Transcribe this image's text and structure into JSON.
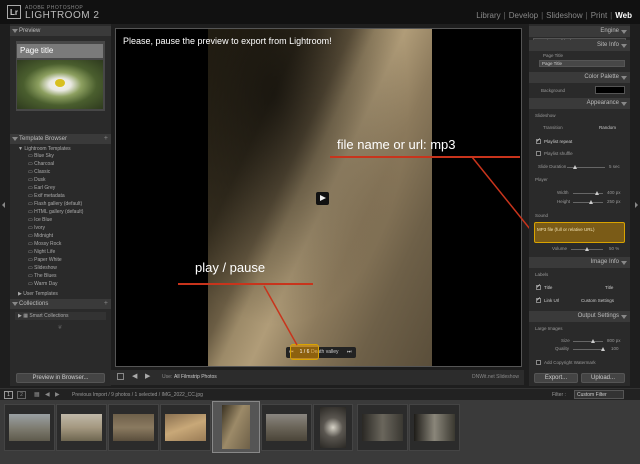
{
  "app": {
    "vendor": "ADOBE PHOTOSHOP",
    "name": "LIGHTROOM 2",
    "badge": "Lr"
  },
  "modules": [
    "Library",
    "Develop",
    "Slideshow",
    "Print",
    "Web"
  ],
  "active_module": "Web",
  "left_panel": {
    "preview_header": "Preview",
    "preview_caption": "Page title",
    "template_browser_header": "Template Browser",
    "lightroom_templates": "Lightroom Templates",
    "templates": [
      "Blue Sky",
      "Charcoal",
      "Classic",
      "Dusk",
      "Earl Grey",
      "Exif metadata",
      "Flash gallery (default)",
      "HTML gallery (default)",
      "Ice Blue",
      "Ivory",
      "Midnight",
      "Mossy Rock",
      "Night Life",
      "Paper White",
      "Slideshow",
      "The Blues",
      "Warm Day"
    ],
    "user_templates": "User Templates",
    "collections_header": "Collections",
    "smart_collections": "Smart Collections",
    "preview_button": "Preview in Browser..."
  },
  "center": {
    "notice": "Please, pause the preview to export from Lightroom!",
    "pill_text": "1 / 6",
    "ctrl_label": "Death valley",
    "annotation_mp3": "file name or url: mp3",
    "annotation_play": "play / pause"
  },
  "center_bar": {
    "use_label": "Use:",
    "use_value": "All Filmstrip Photos",
    "engine_label": "DNWit.net Slideshow"
  },
  "right_panel": {
    "engine_header": "Engine",
    "engine_value": "DNWit.net Slideshow",
    "site_info_header": "Site Info",
    "site_info_label": "Page Title",
    "site_info_value": "Page Title",
    "color_palette_header": "Color Palette",
    "background_label": "Background",
    "appearance_header": "Appearance",
    "slideshow_label": "Slideshow",
    "transition_label": "Transition",
    "transition_value": "Random",
    "playlist_repeat": "Playlist repeat",
    "playlist_shuffle": "Playlist shuffle",
    "slide_duration_label": "Slide Duration",
    "slide_duration_value": "5 sec",
    "player_label": "Player",
    "width_label": "Width",
    "width_value": "400 px",
    "height_label": "Height",
    "height_value": "250 px",
    "sound_label": "Sound",
    "mp3_placeholder": "MP3 file (full or relative URL)",
    "volume_label": "Volume",
    "volume_value": "50 %",
    "image_info_header": "Image Info",
    "labels_label": "Labels",
    "title_label": "Title",
    "title_value": "Title",
    "link_url_label": "Link Url",
    "link_url_value": "Custom Settings",
    "output_settings_header": "Output Settings",
    "large_images_label": "Large Images",
    "size_label": "Size",
    "size_value": "800 px",
    "quality_label": "Quality",
    "quality_value": "100",
    "copyright_watermark": "Add Copyright Watermark",
    "export_button": "Export...",
    "upload_button": "Upload..."
  },
  "filmstrip": {
    "page1": "1",
    "page2": "2",
    "breadcrumb": "Previous Import / 9 photos / 1 selected / IMG_2022_CC.jpg",
    "filter_label": "Filter :",
    "filter_value": "Custom Filter"
  },
  "colors": {
    "accent": "#d9a300",
    "annotation_line": "#c8341c",
    "panel_bg": "#2a2a2a",
    "header_bg": "#3a3a3a"
  }
}
